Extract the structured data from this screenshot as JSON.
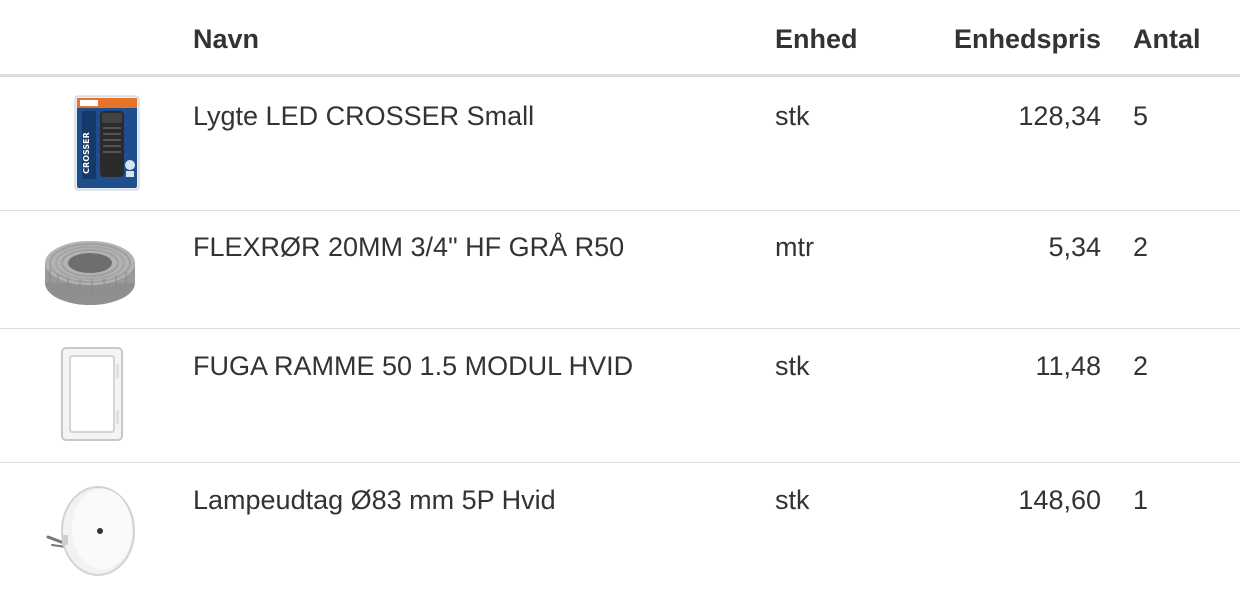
{
  "table": {
    "headers": {
      "image": "",
      "name": "Navn",
      "unit": "Enhed",
      "price": "Enhedspris",
      "quantity": "Antal"
    },
    "rows": [
      {
        "image_icon": "flashlight-package-icon",
        "name": "Lygte LED CROSSER Small",
        "unit": "stk",
        "price": "128,34",
        "quantity": "5"
      },
      {
        "image_icon": "conduit-coil-icon",
        "name": "FLEXRØR 20MM 3/4\" HF GRÅ R50",
        "unit": "mtr",
        "price": "5,34",
        "quantity": "2"
      },
      {
        "image_icon": "frame-icon",
        "name": "FUGA RAMME 50 1.5 MODUL HVID",
        "unit": "stk",
        "price": "11,48",
        "quantity": "2"
      },
      {
        "image_icon": "ceiling-outlet-icon",
        "name": "Lampeudtag Ø83 mm 5P Hvid",
        "unit": "stk",
        "price": "148,60",
        "quantity": "1"
      }
    ]
  }
}
